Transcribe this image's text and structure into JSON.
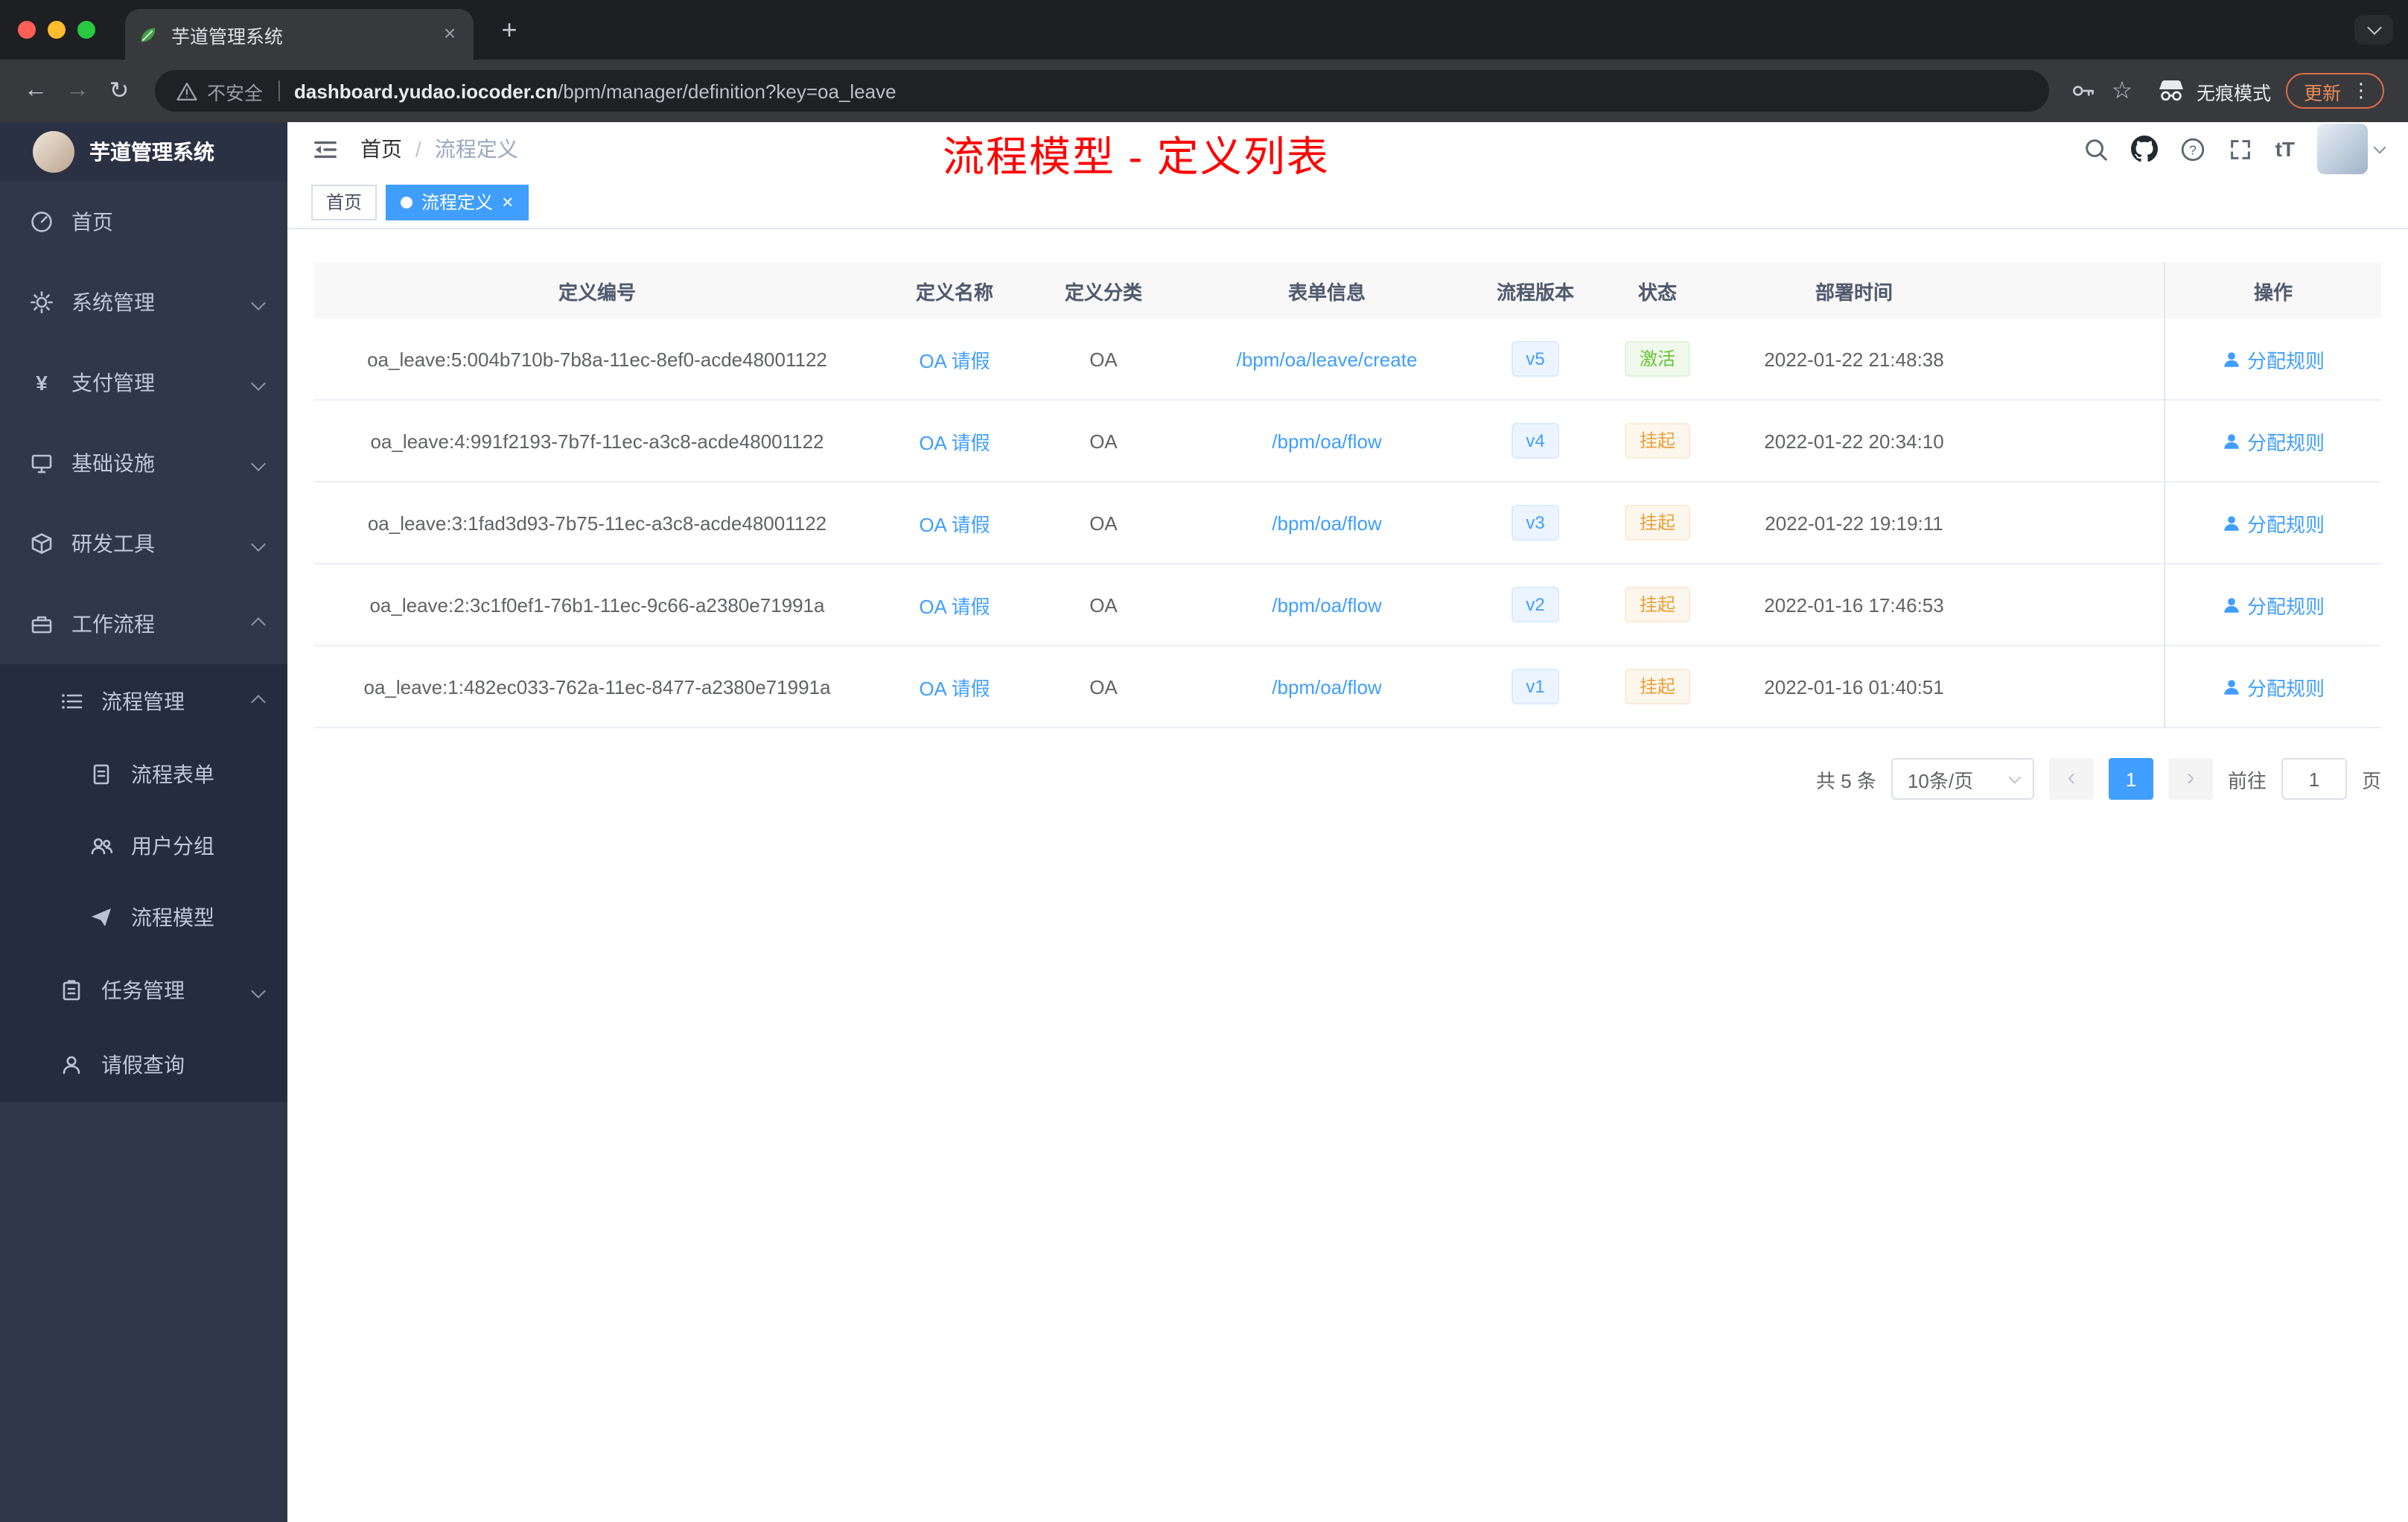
{
  "browser": {
    "tab": {
      "title": "芋道管理系统"
    },
    "address": {
      "security_label": "不安全",
      "domain": "dashboard.yudao.iocoder.cn",
      "path": "/bpm/manager/definition?key=oa_leave"
    },
    "incognito_label": "无痕模式",
    "update_label": "更新"
  },
  "sidebar": {
    "title": "芋道管理系统",
    "items": [
      {
        "label": "首页"
      },
      {
        "label": "系统管理"
      },
      {
        "label": "支付管理"
      },
      {
        "label": "基础设施"
      },
      {
        "label": "研发工具"
      },
      {
        "label": "工作流程"
      },
      {
        "label": "流程管理"
      },
      {
        "label": "流程表单"
      },
      {
        "label": "用户分组"
      },
      {
        "label": "流程模型"
      },
      {
        "label": "任务管理"
      },
      {
        "label": "请假查询"
      }
    ]
  },
  "header": {
    "breadcrumb": {
      "home": "首页",
      "current": "流程定义"
    },
    "annotation": "流程模型 - 定义列表"
  },
  "tags": {
    "home": "首页",
    "active": "流程定义"
  },
  "table": {
    "columns": [
      "定义编号",
      "定义名称",
      "定义分类",
      "表单信息",
      "流程版本",
      "状态",
      "部署时间",
      "操作"
    ],
    "rows": [
      {
        "id": "oa_leave:5:004b710b-7b8a-11ec-8ef0-acde48001122",
        "name": "OA 请假",
        "category": "OA",
        "form": "/bpm/oa/leave/create",
        "version": "v5",
        "status": "激活",
        "status_type": "success",
        "deployed_at": "2022-01-22 21:48:38",
        "action": "分配规则"
      },
      {
        "id": "oa_leave:4:991f2193-7b7f-11ec-a3c8-acde48001122",
        "name": "OA 请假",
        "category": "OA",
        "form": "/bpm/oa/flow",
        "version": "v4",
        "status": "挂起",
        "status_type": "warning",
        "deployed_at": "2022-01-22 20:34:10",
        "action": "分配规则"
      },
      {
        "id": "oa_leave:3:1fad3d93-7b75-11ec-a3c8-acde48001122",
        "name": "OA 请假",
        "category": "OA",
        "form": "/bpm/oa/flow",
        "version": "v3",
        "status": "挂起",
        "status_type": "warning",
        "deployed_at": "2022-01-22 19:19:11",
        "action": "分配规则"
      },
      {
        "id": "oa_leave:2:3c1f0ef1-76b1-11ec-9c66-a2380e71991a",
        "name": "OA 请假",
        "category": "OA",
        "form": "/bpm/oa/flow",
        "version": "v2",
        "status": "挂起",
        "status_type": "warning",
        "deployed_at": "2022-01-16 17:46:53",
        "action": "分配规则"
      },
      {
        "id": "oa_leave:1:482ec033-762a-11ec-8477-a2380e71991a",
        "name": "OA 请假",
        "category": "OA",
        "form": "/bpm/oa/flow",
        "version": "v1",
        "status": "挂起",
        "status_type": "warning",
        "deployed_at": "2022-01-16 01:40:51",
        "action": "分配规则"
      }
    ]
  },
  "pagination": {
    "total": "共 5 条",
    "page_size": "10条/页",
    "page": "1",
    "goto_label": "前往",
    "goto_value": "1",
    "goto_unit": "页"
  },
  "colors": {
    "accent": "#409eff",
    "annotation": "#ff0000",
    "success": "#67c23a",
    "warning": "#e6a23c"
  }
}
